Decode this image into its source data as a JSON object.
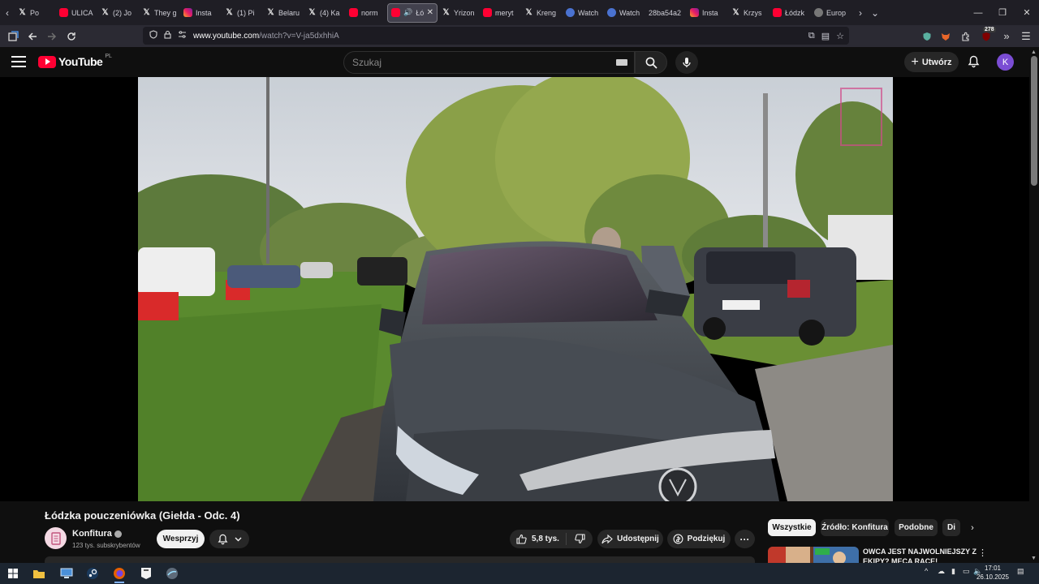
{
  "browser": {
    "tabs": [
      {
        "label": "Po",
        "favicon": "x-icon"
      },
      {
        "label": "ULICA",
        "favicon": "youtube-icon"
      },
      {
        "label": "(2) Jo",
        "favicon": "x-icon"
      },
      {
        "label": "They g",
        "favicon": "x-icon"
      },
      {
        "label": "Insta",
        "favicon": "instagram-icon"
      },
      {
        "label": "(1) Pi",
        "favicon": "x-icon"
      },
      {
        "label": "Belaru",
        "favicon": "x-icon"
      },
      {
        "label": "(4) Ka",
        "favicon": "x-icon"
      },
      {
        "label": "norm",
        "favicon": "youtube-icon"
      },
      {
        "label": "Łód",
        "favicon": "youtube-icon",
        "active": true
      },
      {
        "label": "Yrizon",
        "favicon": "x-icon"
      },
      {
        "label": "meryt",
        "favicon": "youtube-icon"
      },
      {
        "label": "Kreng",
        "favicon": "x-icon"
      },
      {
        "label": "Watch",
        "favicon": "globe-icon"
      },
      {
        "label": "Watch",
        "favicon": "globe-icon"
      },
      {
        "label": "28ba54a2",
        "favicon": "none"
      },
      {
        "label": "Insta",
        "favicon": "instagram-icon"
      },
      {
        "label": "Krzys",
        "favicon": "x-icon"
      },
      {
        "label": "Łódzk",
        "favicon": "youtube-icon"
      },
      {
        "label": "Europ",
        "favicon": "wikipedia-icon"
      }
    ],
    "url": {
      "host": "www.youtube.com",
      "path": "/watch?v=V-ja5dxhhiA"
    },
    "extension_badge": "278"
  },
  "youtube": {
    "logo_text": "YouTube",
    "country_code": "PL",
    "search_placeholder": "Szukaj",
    "create_label": "Utwórz",
    "avatar_letter": "K"
  },
  "video": {
    "title": "Łódzka pouczeniówka (Giełda - Odc. 4)",
    "channel_name": "Konfitura",
    "subscribers": "123 tys. subskrybentów",
    "support_label": "Wesprzyj",
    "likes": "5,8 tys.",
    "share_label": "Udostępnij",
    "thanks_label": "Podziękuj"
  },
  "sidebar": {
    "chips": [
      "Wszystkie",
      "Źródło: Konfitura",
      "Podobne",
      "Di"
    ],
    "recommendation_title": "OWCA JEST NAJWOLNIEJSZY Z EKIPY? MECA RACE!"
  },
  "taskbar": {
    "time": "17:01",
    "date": "26.10.2025"
  },
  "colors": {
    "youtube_red": "#ff0033",
    "background": "#0f0f0f",
    "avatar_purple": "#7b4dd4"
  }
}
